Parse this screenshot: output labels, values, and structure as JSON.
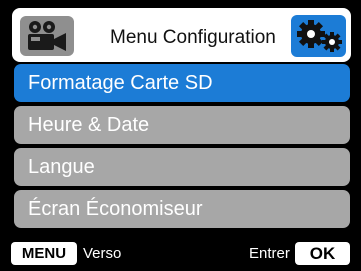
{
  "header": {
    "title": "Menu Configuration",
    "left_icon": "video-camera-icon",
    "right_icon": "gears-icon"
  },
  "menu": {
    "items": [
      {
        "label": "Formatage Carte SD",
        "selected": true
      },
      {
        "label": "Heure & Date",
        "selected": false
      },
      {
        "label": "Langue",
        "selected": false
      },
      {
        "label": "Écran Économiseur",
        "selected": false
      }
    ]
  },
  "footer": {
    "menu_key": "MENU",
    "back_label": "Verso",
    "enter_label": "Entrer",
    "ok_key": "OK"
  },
  "colors": {
    "accent": "#1c7cd6",
    "item_bg": "#a7a7a7",
    "background": "#000000"
  }
}
